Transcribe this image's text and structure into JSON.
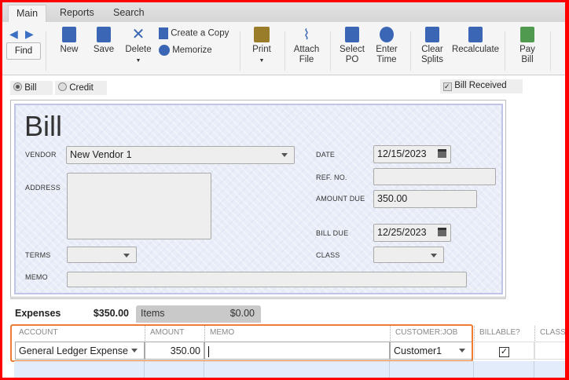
{
  "tabs": [
    "Main",
    "Reports",
    "Search"
  ],
  "toolbar": {
    "find": "Find",
    "new": "New",
    "save": "Save",
    "delete": "Delete",
    "create_copy": "Create a Copy",
    "memorize": "Memorize",
    "print": "Print",
    "attach": [
      "Attach",
      "File"
    ],
    "select_po": [
      "Select",
      "PO"
    ],
    "enter_time": [
      "Enter",
      "Time"
    ],
    "clear_splits": [
      "Clear",
      "Splits"
    ],
    "recalculate": "Recalculate",
    "pay_bill": [
      "Pay",
      "Bill"
    ]
  },
  "type": {
    "bill": "Bill",
    "credit": "Credit",
    "bill_received": "Bill Received"
  },
  "form": {
    "title": "Bill",
    "vendor_label": "VENDOR",
    "vendor": "New Vendor 1",
    "address_label": "ADDRESS",
    "terms_label": "TERMS",
    "memo_label": "MEMO",
    "date_label": "DATE",
    "date": "12/15/2023",
    "ref_label": "REF. NO.",
    "amount_due_label": "AMOUNT DUE",
    "amount_due": "350.00",
    "bill_due_label": "BILL DUE",
    "bill_due": "12/25/2023",
    "class_label": "CLASS"
  },
  "detail_tabs": {
    "expenses": "Expenses",
    "expenses_total": "$350.00",
    "items": "Items",
    "items_total": "$0.00"
  },
  "grid": {
    "headers": [
      "ACCOUNT",
      "AMOUNT",
      "MEMO",
      "CUSTOMER:JOB",
      "BILLABLE?",
      "CLASS"
    ],
    "row": {
      "account": "General Ledger Expense",
      "amount": "350.00",
      "memo": "",
      "customer": "Customer1",
      "billable": "✓"
    }
  }
}
